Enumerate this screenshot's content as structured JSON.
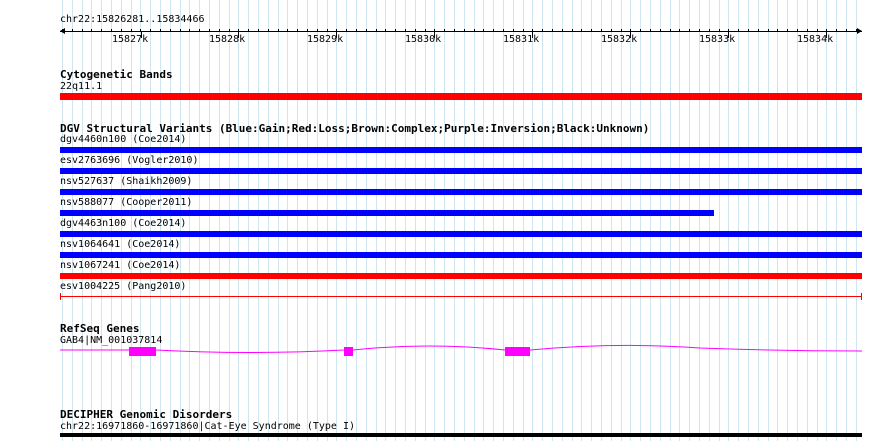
{
  "ruler": {
    "range_label": "chr22:15826281..15834466",
    "tick_labels": [
      "15827k",
      "15828k",
      "15829k",
      "15830k",
      "15831k",
      "15832k",
      "15833k",
      "15834k"
    ]
  },
  "tracks": {
    "cytoband": {
      "title": "Cytogenetic Bands",
      "label": "22q11.1",
      "color": "#ff0000"
    },
    "dgv": {
      "title": "DGV Structural Variants (Blue:Gain;Red:Loss;Brown:Complex;Purple:Inversion;Black:Unknown)",
      "features": [
        {
          "label": "dgv4460n100 (Coe2014)",
          "type": "gain",
          "color": "#0000ff"
        },
        {
          "label": "esv2763696 (Vogler2010)",
          "type": "gain",
          "color": "#0000ff"
        },
        {
          "label": "nsv527637 (Shaikh2009)",
          "type": "gain",
          "color": "#0000ff"
        },
        {
          "label": "nsv588077 (Cooper2011)",
          "type": "gain",
          "color": "#0000ff"
        },
        {
          "label": "dgv4463n100 (Coe2014)",
          "type": "gain",
          "color": "#0000ff"
        },
        {
          "label": "nsv1064641 (Coe2014)",
          "type": "gain",
          "color": "#0000ff"
        },
        {
          "label": "nsv1067241 (Coe2014)",
          "type": "loss",
          "color": "#ff0000"
        },
        {
          "label": "esv1004225 (Pang2010)",
          "type": "loss",
          "color": "#ff0000"
        }
      ]
    },
    "refseq": {
      "title": "RefSeq Genes",
      "label": "GAB4|NM_001037814",
      "color": "#ff00ff"
    },
    "decipher": {
      "title": "DECIPHER Genomic Disorders",
      "label": "chr22:16971860-16971860|Cat-Eye Syndrome (Type I)",
      "color": "#000000"
    }
  }
}
